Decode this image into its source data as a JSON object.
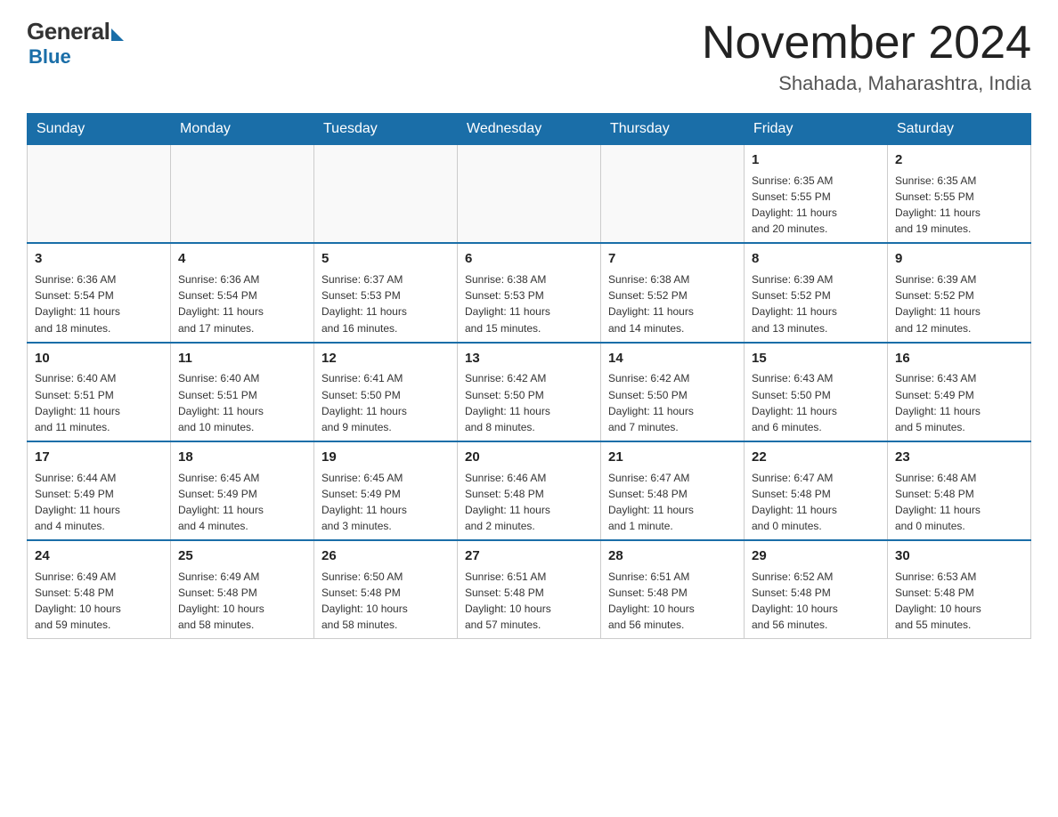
{
  "logo": {
    "general": "General",
    "blue": "Blue"
  },
  "title": "November 2024",
  "subtitle": "Shahada, Maharashtra, India",
  "days_of_week": [
    "Sunday",
    "Monday",
    "Tuesday",
    "Wednesday",
    "Thursday",
    "Friday",
    "Saturday"
  ],
  "weeks": [
    [
      {
        "day": "",
        "info": ""
      },
      {
        "day": "",
        "info": ""
      },
      {
        "day": "",
        "info": ""
      },
      {
        "day": "",
        "info": ""
      },
      {
        "day": "",
        "info": ""
      },
      {
        "day": "1",
        "info": "Sunrise: 6:35 AM\nSunset: 5:55 PM\nDaylight: 11 hours\nand 20 minutes."
      },
      {
        "day": "2",
        "info": "Sunrise: 6:35 AM\nSunset: 5:55 PM\nDaylight: 11 hours\nand 19 minutes."
      }
    ],
    [
      {
        "day": "3",
        "info": "Sunrise: 6:36 AM\nSunset: 5:54 PM\nDaylight: 11 hours\nand 18 minutes."
      },
      {
        "day": "4",
        "info": "Sunrise: 6:36 AM\nSunset: 5:54 PM\nDaylight: 11 hours\nand 17 minutes."
      },
      {
        "day": "5",
        "info": "Sunrise: 6:37 AM\nSunset: 5:53 PM\nDaylight: 11 hours\nand 16 minutes."
      },
      {
        "day": "6",
        "info": "Sunrise: 6:38 AM\nSunset: 5:53 PM\nDaylight: 11 hours\nand 15 minutes."
      },
      {
        "day": "7",
        "info": "Sunrise: 6:38 AM\nSunset: 5:52 PM\nDaylight: 11 hours\nand 14 minutes."
      },
      {
        "day": "8",
        "info": "Sunrise: 6:39 AM\nSunset: 5:52 PM\nDaylight: 11 hours\nand 13 minutes."
      },
      {
        "day": "9",
        "info": "Sunrise: 6:39 AM\nSunset: 5:52 PM\nDaylight: 11 hours\nand 12 minutes."
      }
    ],
    [
      {
        "day": "10",
        "info": "Sunrise: 6:40 AM\nSunset: 5:51 PM\nDaylight: 11 hours\nand 11 minutes."
      },
      {
        "day": "11",
        "info": "Sunrise: 6:40 AM\nSunset: 5:51 PM\nDaylight: 11 hours\nand 10 minutes."
      },
      {
        "day": "12",
        "info": "Sunrise: 6:41 AM\nSunset: 5:50 PM\nDaylight: 11 hours\nand 9 minutes."
      },
      {
        "day": "13",
        "info": "Sunrise: 6:42 AM\nSunset: 5:50 PM\nDaylight: 11 hours\nand 8 minutes."
      },
      {
        "day": "14",
        "info": "Sunrise: 6:42 AM\nSunset: 5:50 PM\nDaylight: 11 hours\nand 7 minutes."
      },
      {
        "day": "15",
        "info": "Sunrise: 6:43 AM\nSunset: 5:50 PM\nDaylight: 11 hours\nand 6 minutes."
      },
      {
        "day": "16",
        "info": "Sunrise: 6:43 AM\nSunset: 5:49 PM\nDaylight: 11 hours\nand 5 minutes."
      }
    ],
    [
      {
        "day": "17",
        "info": "Sunrise: 6:44 AM\nSunset: 5:49 PM\nDaylight: 11 hours\nand 4 minutes."
      },
      {
        "day": "18",
        "info": "Sunrise: 6:45 AM\nSunset: 5:49 PM\nDaylight: 11 hours\nand 4 minutes."
      },
      {
        "day": "19",
        "info": "Sunrise: 6:45 AM\nSunset: 5:49 PM\nDaylight: 11 hours\nand 3 minutes."
      },
      {
        "day": "20",
        "info": "Sunrise: 6:46 AM\nSunset: 5:48 PM\nDaylight: 11 hours\nand 2 minutes."
      },
      {
        "day": "21",
        "info": "Sunrise: 6:47 AM\nSunset: 5:48 PM\nDaylight: 11 hours\nand 1 minute."
      },
      {
        "day": "22",
        "info": "Sunrise: 6:47 AM\nSunset: 5:48 PM\nDaylight: 11 hours\nand 0 minutes."
      },
      {
        "day": "23",
        "info": "Sunrise: 6:48 AM\nSunset: 5:48 PM\nDaylight: 11 hours\nand 0 minutes."
      }
    ],
    [
      {
        "day": "24",
        "info": "Sunrise: 6:49 AM\nSunset: 5:48 PM\nDaylight: 10 hours\nand 59 minutes."
      },
      {
        "day": "25",
        "info": "Sunrise: 6:49 AM\nSunset: 5:48 PM\nDaylight: 10 hours\nand 58 minutes."
      },
      {
        "day": "26",
        "info": "Sunrise: 6:50 AM\nSunset: 5:48 PM\nDaylight: 10 hours\nand 58 minutes."
      },
      {
        "day": "27",
        "info": "Sunrise: 6:51 AM\nSunset: 5:48 PM\nDaylight: 10 hours\nand 57 minutes."
      },
      {
        "day": "28",
        "info": "Sunrise: 6:51 AM\nSunset: 5:48 PM\nDaylight: 10 hours\nand 56 minutes."
      },
      {
        "day": "29",
        "info": "Sunrise: 6:52 AM\nSunset: 5:48 PM\nDaylight: 10 hours\nand 56 minutes."
      },
      {
        "day": "30",
        "info": "Sunrise: 6:53 AM\nSunset: 5:48 PM\nDaylight: 10 hours\nand 55 minutes."
      }
    ]
  ]
}
